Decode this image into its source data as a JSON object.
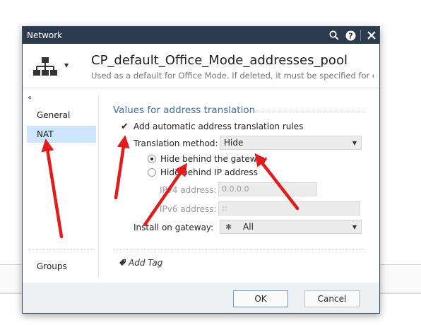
{
  "window": {
    "title": "Network",
    "icons": [
      "search-icon",
      "help-icon",
      "close-icon"
    ]
  },
  "header": {
    "object_icon": "network-tree-icon",
    "name": "CP_default_Office_Mode_addresses_pool",
    "description": "Used as a default for Office Mode. If deleted, it must be specified for each..."
  },
  "sidebar": {
    "collapse_glyph": "‹‹",
    "items": [
      {
        "label": "General",
        "active": false
      },
      {
        "label": "NAT",
        "active": true
      },
      {
        "label": "Groups",
        "active": false
      }
    ]
  },
  "nat": {
    "section_title": "Values for address translation",
    "auto_rules": {
      "label": "Add automatic address translation rules",
      "checked": true,
      "mark": "✔"
    },
    "method": {
      "label": "Translation method:",
      "value": "Hide"
    },
    "hide_gateway": {
      "label": "Hide behind the gateway",
      "selected": true
    },
    "hide_ip": {
      "label": "Hide behind IP address",
      "selected": false
    },
    "ipv4": {
      "label": "IPv4 address:",
      "value": "0.0.0.0"
    },
    "ipv6": {
      "label": "IPv6 address:",
      "value": "::"
    },
    "install": {
      "label": "Install on gateway:",
      "value": "All",
      "value_icon": "✱"
    }
  },
  "add_tag": {
    "label": "Add Tag"
  },
  "footer": {
    "ok": "OK",
    "cancel": "Cancel"
  },
  "colors": {
    "titlebar": "#2b3a4c",
    "accent": "#3b6fb0",
    "selected": "#cde6fb",
    "annotation_arrow": "#e51b1b"
  }
}
